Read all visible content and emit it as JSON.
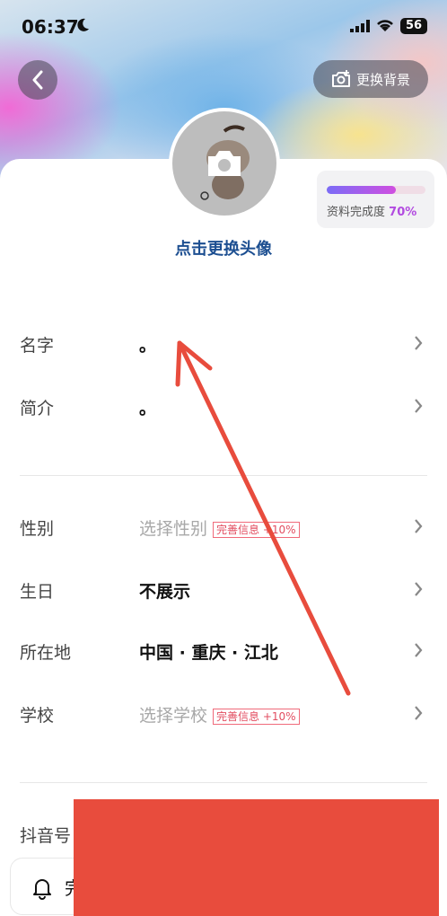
{
  "status_bar": {
    "time": "06:37",
    "battery": "56"
  },
  "header": {
    "change_background_label": "更换背景"
  },
  "profile": {
    "change_avatar_label": "点击更换头像",
    "completion": {
      "label": "资料完成度",
      "percent_text": "70%",
      "fraction": 0.7
    }
  },
  "fields": {
    "name": {
      "label": "名字",
      "value": "。"
    },
    "bio": {
      "label": "简介",
      "value": "。"
    },
    "gender": {
      "label": "性别",
      "value": "选择性别",
      "badge": "完善信息 +10%"
    },
    "birthday": {
      "label": "生日",
      "value": "不展示"
    },
    "location": {
      "label": "所在地",
      "value": "中国 · 重庆 · 江北"
    },
    "school": {
      "label": "学校",
      "value": "选择学校",
      "badge": "完善信息 +10%"
    },
    "douyin_id": {
      "label": "抖音号"
    }
  },
  "footer": {
    "button_label": "完"
  },
  "colors": {
    "accent_blue": "#1d4f91",
    "progress_purple": "#b24be0",
    "badge_red": "#e24d60",
    "annotation_red": "#e84c3d"
  }
}
